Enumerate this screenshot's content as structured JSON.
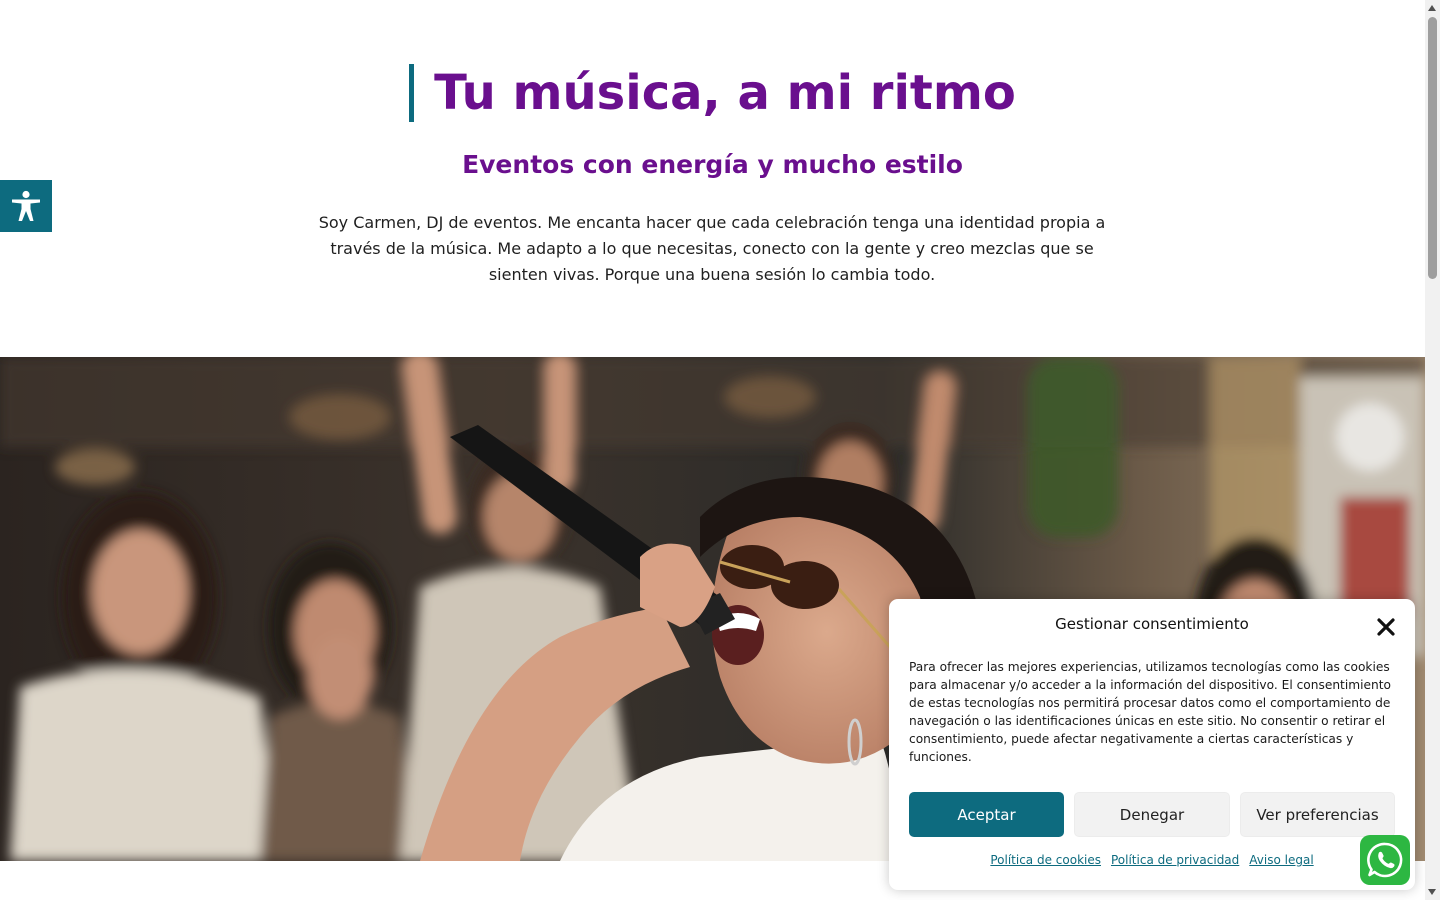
{
  "hero": {
    "title": "Tu música, a mi ritmo",
    "subtitle": "Eventos con energía y mucho estilo",
    "intro": "Soy Carmen, DJ de eventos. Me encanta hacer que cada celebración tenga una identidad propia a través de la música. Me adapto a lo que necesitas, conecto con la gente y creo mezclas que se sienten vivas. Porque una buena sesión lo cambia todo."
  },
  "accessibility": {
    "icon": "accessibility-icon"
  },
  "cookie": {
    "title": "Gestionar consentimiento",
    "text": "Para ofrecer las mejores experiencias, utilizamos tecnologías como las cookies para almacenar y/o acceder a la información del dispositivo. El consentimiento de estas tecnologías nos permitirá procesar datos como el comportamiento de navegación o las identificaciones únicas en este sitio. No consentir o retirar el consentimiento, puede afectar negativamente a ciertas características y funciones.",
    "accept": "Aceptar",
    "deny": "Denegar",
    "preferences": "Ver preferencias",
    "links": [
      "Política de cookies",
      "Política de privacidad",
      "Aviso legal"
    ]
  },
  "whatsapp": {
    "icon": "whatsapp-icon"
  },
  "colors": {
    "brand_purple": "#6a0f8e",
    "accent_teal": "#0d6b7f",
    "whatsapp_green": "#2db742"
  }
}
